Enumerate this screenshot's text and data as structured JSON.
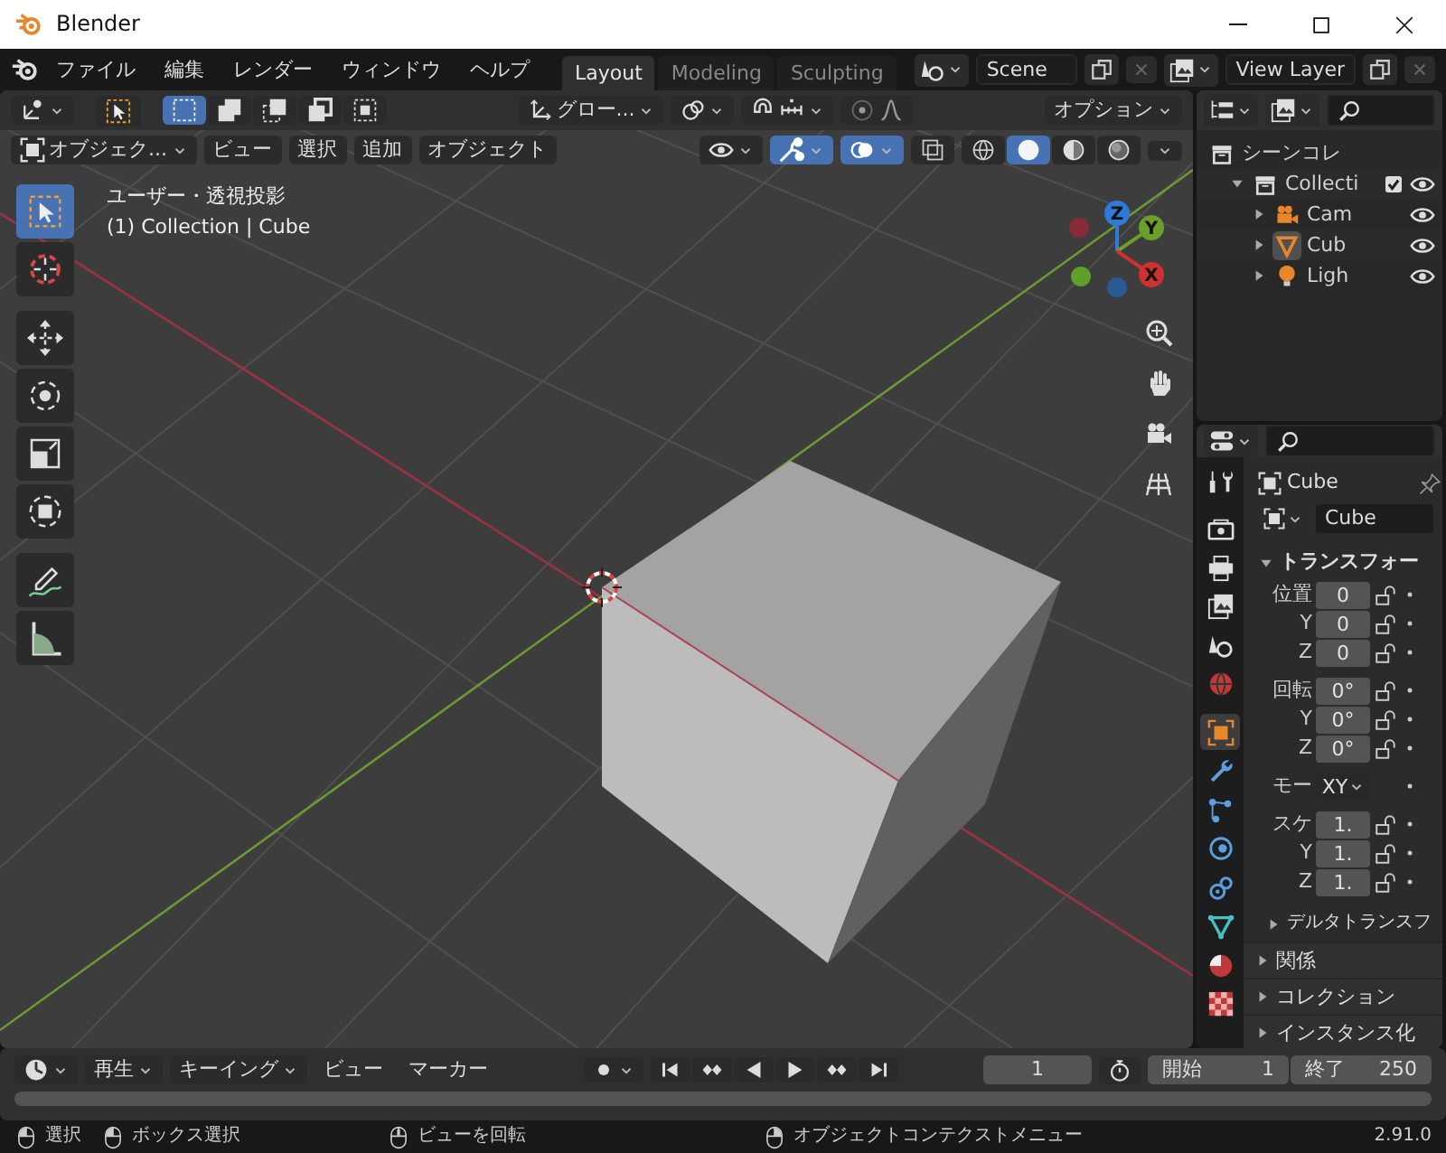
{
  "window": {
    "title": "Blender"
  },
  "menus": [
    "ファイル",
    "編集",
    "レンダー",
    "ウィンドウ",
    "ヘルプ"
  ],
  "workspaces": [
    {
      "label": "Layout",
      "selected": true
    },
    {
      "label": "Modeling",
      "selected": false
    },
    {
      "label": "Sculpting",
      "selected": false
    }
  ],
  "scene": {
    "value": "Scene"
  },
  "view_layer": {
    "value": "View Layer"
  },
  "viewport": {
    "select_modes": [
      {
        "selected": true
      },
      {
        "selected": false
      },
      {
        "selected": false
      },
      {
        "selected": false
      },
      {
        "selected": false
      }
    ],
    "orientation": "グロー...",
    "options": "オプション",
    "mode": "オブジェク...",
    "menus": [
      "ビュー",
      "選択",
      "追加",
      "オブジェクト"
    ],
    "toggles": [
      {
        "kind": "gizmo",
        "on": true
      },
      {
        "kind": "overlay",
        "on": true
      },
      {
        "kind": "xray",
        "on": false
      }
    ],
    "shading": [
      {
        "kind": "wireframe",
        "selected": false
      },
      {
        "kind": "solid",
        "selected": true
      },
      {
        "kind": "material",
        "selected": false
      },
      {
        "kind": "rendered",
        "selected": false
      }
    ],
    "view_name": "ユーザー・透視投影",
    "context": "(1) Collection | Cube",
    "tools": [
      {
        "kind": "select",
        "selected": true
      },
      {
        "kind": "cursor",
        "selected": false
      },
      {
        "kind": "move",
        "selected": false
      },
      {
        "kind": "rotate",
        "selected": false
      },
      {
        "kind": "scale",
        "selected": false
      },
      {
        "kind": "transform",
        "selected": false
      },
      {
        "kind": "annotate",
        "selected": false
      },
      {
        "kind": "measure",
        "selected": false
      }
    ],
    "axes": [
      {
        "label": "Z"
      },
      {
        "label": "Y"
      },
      {
        "label": "X"
      }
    ]
  },
  "outliner": {
    "items": [
      {
        "label": "シーンコレ",
        "kind": "collection",
        "children": [
          {
            "label": "Collecti",
            "kind": "collection",
            "expanded": true,
            "checked": true,
            "selected": false,
            "children": [
              {
                "label": "Cam",
                "kind": "camera",
                "expanded": false,
                "selected": false
              },
              {
                "label": "Cub",
                "kind": "mesh",
                "expanded": false,
                "selected": true
              },
              {
                "label": "Ligh",
                "kind": "light",
                "expanded": false,
                "selected": false
              }
            ]
          }
        ]
      }
    ]
  },
  "properties": {
    "tabs": [
      {
        "kind": "tool",
        "selected": false
      },
      {
        "kind": "render",
        "selected": false
      },
      {
        "kind": "output",
        "selected": false
      },
      {
        "kind": "view_layer",
        "selected": false
      },
      {
        "kind": "scene",
        "selected": false
      },
      {
        "kind": "world",
        "selected": false
      },
      {
        "kind": "object",
        "selected": true
      },
      {
        "kind": "modifiers",
        "selected": false
      },
      {
        "kind": "particles",
        "selected": false
      },
      {
        "kind": "physics",
        "selected": false
      },
      {
        "kind": "constraints",
        "selected": false
      },
      {
        "kind": "data",
        "selected": false
      },
      {
        "kind": "material",
        "selected": false
      },
      {
        "kind": "texture",
        "selected": false
      }
    ],
    "context": "Cube",
    "name": "Cube",
    "panel": {
      "title": "トランスフォー",
      "expanded": true,
      "groups": [
        {
          "kind": "vector",
          "rows": [
            {
              "label": "位置",
              "value": "0"
            },
            {
              "label": "Y",
              "value": "0"
            },
            {
              "label": "Z",
              "value": "0"
            }
          ]
        },
        {
          "kind": "vector",
          "rows": [
            {
              "label": "回転",
              "value": "0°"
            },
            {
              "label": "Y",
              "value": "0°"
            },
            {
              "label": "Z",
              "value": "0°"
            }
          ]
        },
        {
          "kind": "select",
          "rows": [
            {
              "label": "モー",
              "value": "XY"
            }
          ]
        },
        {
          "kind": "vector",
          "rows": [
            {
              "label": "スケ",
              "value": "1."
            },
            {
              "label": "Y",
              "value": "1."
            },
            {
              "label": "Z",
              "value": "1."
            }
          ]
        }
      ],
      "subpanels": [
        {
          "title": "デルタトランスフ",
          "expanded": false
        }
      ]
    },
    "panels": [
      {
        "title": "関係",
        "expanded": false
      },
      {
        "title": "コレクション",
        "expanded": false
      },
      {
        "title": "インスタンス化",
        "expanded": false
      }
    ]
  },
  "timeline": {
    "menus": [
      {
        "label": "再生",
        "dropdown": true
      },
      {
        "label": "キーイング",
        "dropdown": true
      },
      {
        "label": "ビュー",
        "dropdown": false
      },
      {
        "label": "マーカー",
        "dropdown": false
      }
    ],
    "current_frame": "1",
    "start": {
      "label": "開始",
      "value": "1"
    },
    "end": {
      "label": "終了",
      "value": "250"
    }
  },
  "status": {
    "items": [
      {
        "kind": "left",
        "text": "選択"
      },
      {
        "kind": "left_drag",
        "text": "ボックス選択"
      },
      {
        "kind": "middle",
        "text": "ビューを回転"
      },
      {
        "kind": "right",
        "text": "オブジェクトコンテクストメニュー"
      }
    ],
    "version": "2.91.0"
  }
}
